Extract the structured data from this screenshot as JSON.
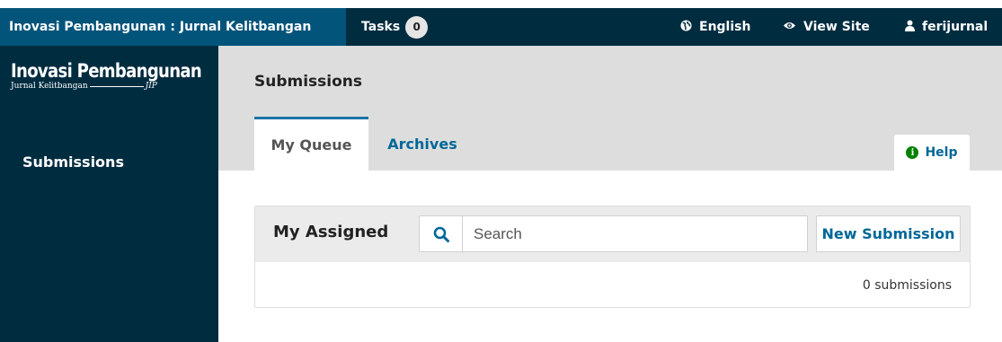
{
  "topbar": {
    "journal_name": "Inovasi Pembangunan : Jurnal Kelitbangan",
    "tasks_label": "Tasks",
    "tasks_count": "0",
    "language": "English",
    "view_site": "View Site",
    "username": "ferijurnal"
  },
  "sidebar": {
    "logo_title": "Inovasi Pembangunan",
    "logo_subtitle": "Jurnal Kelitbangan",
    "logo_suffix": "JIP",
    "items": [
      {
        "label": "Submissions"
      }
    ]
  },
  "main": {
    "page_title": "Submissions",
    "tabs": [
      {
        "label": "My Queue",
        "active": true
      },
      {
        "label": "Archives",
        "active": false
      }
    ],
    "help_label": "Help",
    "panel": {
      "title": "My Assigned",
      "search_placeholder": "Search",
      "new_submission_label": "New Submission",
      "count_text": "0 submissions"
    }
  },
  "colors": {
    "topbar_bg": "#002c40",
    "brand_bg": "#03547a",
    "accent": "#006798",
    "header_bg": "#dddddd",
    "help_icon": "#008000"
  },
  "icons": {
    "language": "globe-icon",
    "view_site": "eye-icon",
    "user": "user-icon",
    "search": "search-icon",
    "help": "info-icon"
  }
}
